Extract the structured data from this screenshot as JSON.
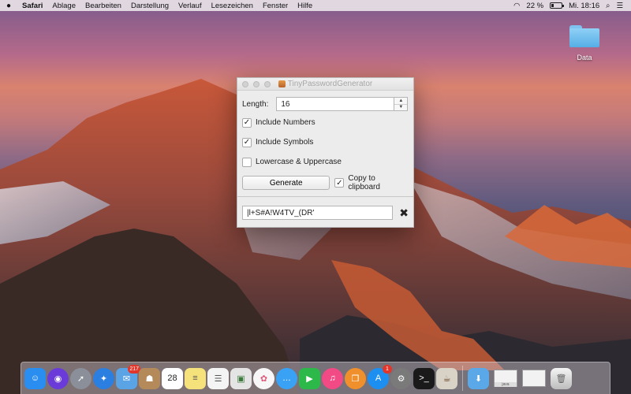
{
  "menubar": {
    "app_name": "Safari",
    "items": [
      "Ablage",
      "Bearbeiten",
      "Darstellung",
      "Verlauf",
      "Lesezeichen",
      "Fenster",
      "Hilfe"
    ],
    "battery_percent": "22 %",
    "battery_level": 0.22,
    "clock": "Mi. 18:16"
  },
  "desktop": {
    "folder_label": "Data"
  },
  "window": {
    "title": "TinyPasswordGenerator",
    "length_label": "Length:",
    "length_value": "16",
    "include_numbers_label": "Include Numbers",
    "include_numbers_checked": true,
    "include_symbols_label": "Include Symbols",
    "include_symbols_checked": true,
    "case_label": "Lowercase & Uppercase",
    "case_checked": false,
    "generate_label": "Generate",
    "copy_label": "Copy to clipboard",
    "copy_checked": true,
    "password": "|l+S#A!W4TV_(DR'",
    "clear_symbol": "✖"
  },
  "dock": {
    "apps": [
      {
        "name": "finder-icon",
        "color": "#2a8df0",
        "glyph": "☺"
      },
      {
        "name": "siri-icon",
        "color": "#6a3bd8",
        "glyph": "◉",
        "round": true
      },
      {
        "name": "launchpad-icon",
        "color": "#8a8f99",
        "glyph": "➚",
        "round": true
      },
      {
        "name": "safari-icon",
        "color": "#2b7fe0",
        "glyph": "✦",
        "round": true
      },
      {
        "name": "mail-icon",
        "color": "#5aa4e6",
        "glyph": "✉",
        "badge": "217"
      },
      {
        "name": "contacts-icon",
        "color": "#b58a5a",
        "glyph": "☗"
      },
      {
        "name": "calendar-icon",
        "color": "#ffffff",
        "glyph": "28",
        "text_color": "#222"
      },
      {
        "name": "notes-icon",
        "color": "#f5e27a",
        "glyph": "≡",
        "text_color": "#555"
      },
      {
        "name": "reminders-icon",
        "color": "#f4f4f4",
        "glyph": "☰",
        "text_color": "#555"
      },
      {
        "name": "preview-icon",
        "color": "#e4e4e4",
        "glyph": "▣",
        "text_color": "#3d7a3d"
      },
      {
        "name": "photos-icon",
        "color": "#f7f7f7",
        "glyph": "✿",
        "text_color": "#e05a7a",
        "round": true
      },
      {
        "name": "messages-icon",
        "color": "#3aa2f5",
        "glyph": "…",
        "round": true
      },
      {
        "name": "facetime-icon",
        "color": "#2db84a",
        "glyph": "▶"
      },
      {
        "name": "itunes-icon",
        "color": "#f24a84",
        "glyph": "♫",
        "round": true
      },
      {
        "name": "ibooks-icon",
        "color": "#f0902c",
        "glyph": "❐",
        "round": true
      },
      {
        "name": "app-store-icon",
        "color": "#1d8ff0",
        "glyph": "A",
        "badge": "1",
        "round": true
      },
      {
        "name": "system-preferences-icon",
        "color": "#7a7a7a",
        "glyph": "⚙",
        "round": true
      },
      {
        "name": "terminal-icon",
        "color": "#1a1a1a",
        "glyph": ">_"
      },
      {
        "name": "coffee-app-icon",
        "color": "#d9d2c6",
        "glyph": "☕",
        "text_color": "#6a4a2a"
      }
    ],
    "thumb_caption": "java"
  }
}
